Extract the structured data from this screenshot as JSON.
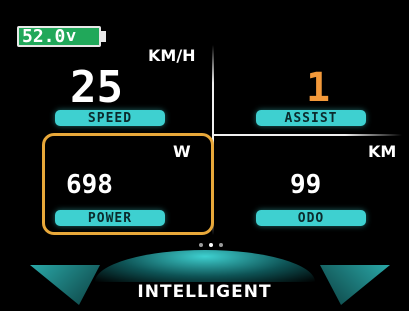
{
  "battery": {
    "voltage": "52.0",
    "unit": "V"
  },
  "speed": {
    "unit": "KM/H",
    "value": "25",
    "label": "SPEED"
  },
  "assist": {
    "value": "1",
    "label": "ASSIST",
    "color": "#f3993a"
  },
  "power": {
    "unit": "W",
    "value": "698",
    "label": "POWER"
  },
  "odo": {
    "unit": "KM",
    "value": "99",
    "label": "ODO"
  },
  "mode": {
    "label": "INTELLIGENT"
  },
  "pager": {
    "active_index": 2,
    "count": 3
  },
  "colors": {
    "accent": "#3ed0d0",
    "battery": "#21a85a",
    "highlight": "#e8a83a",
    "background": "#000000"
  }
}
